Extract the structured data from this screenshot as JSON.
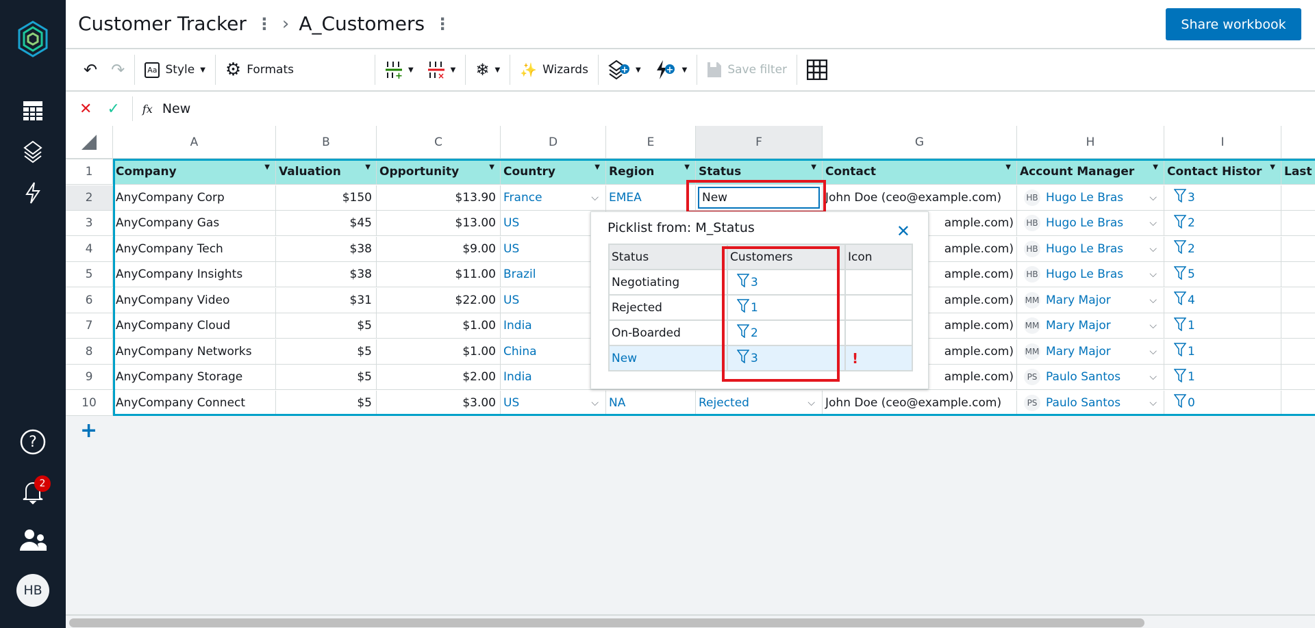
{
  "app": {
    "notifications": 2,
    "user_initials": "HB"
  },
  "header": {
    "workbook": "Customer Tracker",
    "sheet": "A_Customers",
    "share_label": "Share workbook"
  },
  "toolbar": {
    "style": "Style",
    "formats": "Formats",
    "wizards": "Wizards",
    "save_filter": "Save filter"
  },
  "formula": {
    "fx": "fx",
    "value": "New"
  },
  "columns": [
    "A",
    "B",
    "C",
    "D",
    "E",
    "F",
    "G",
    "H",
    "I"
  ],
  "headers": [
    "Company",
    "Valuation",
    "Opportunity",
    "Country",
    "Region",
    "Status",
    "Contact",
    "Account Manager",
    "Contact Histor",
    "Last C"
  ],
  "rows": [
    {
      "n": "2",
      "company": "AnyCompany Corp",
      "valuation": "$150",
      "opportunity": "$13.90",
      "country": "France",
      "region": "EMEA",
      "status": "New",
      "contact": "John Doe (ceo@example.com)",
      "mgr_initials": "HB",
      "manager": "Hugo Le Bras",
      "history": "3"
    },
    {
      "n": "3",
      "company": "AnyCompany Gas",
      "valuation": "$45",
      "opportunity": "$13.00",
      "country": "US",
      "contact": "ample.com)",
      "mgr_initials": "HB",
      "manager": "Hugo Le Bras",
      "history": "2"
    },
    {
      "n": "4",
      "company": "AnyCompany Tech",
      "valuation": "$38",
      "opportunity": "$9.00",
      "country": "US",
      "contact": "ample.com)",
      "mgr_initials": "HB",
      "manager": "Hugo Le Bras",
      "history": "2"
    },
    {
      "n": "5",
      "company": "AnyCompany Insights",
      "valuation": "$38",
      "opportunity": "$11.00",
      "country": "Brazil",
      "contact": "ample.com)",
      "mgr_initials": "HB",
      "manager": "Hugo Le Bras",
      "history": "5"
    },
    {
      "n": "6",
      "company": "AnyCompany Video",
      "valuation": "$31",
      "opportunity": "$22.00",
      "country": "US",
      "contact": "ample.com)",
      "mgr_initials": "MM",
      "manager": "Mary Major",
      "history": "4"
    },
    {
      "n": "7",
      "company": "AnyCompany Cloud",
      "valuation": "$5",
      "opportunity": "$1.00",
      "country": "India",
      "contact": "ample.com)",
      "mgr_initials": "MM",
      "manager": "Mary Major",
      "history": "1"
    },
    {
      "n": "8",
      "company": "AnyCompany Networks",
      "valuation": "$5",
      "opportunity": "$1.00",
      "country": "China",
      "contact": "ample.com)",
      "mgr_initials": "MM",
      "manager": "Mary Major",
      "history": "1"
    },
    {
      "n": "9",
      "company": "AnyCompany Storage",
      "valuation": "$5",
      "opportunity": "$2.00",
      "country": "India",
      "contact": "ample.com)",
      "mgr_initials": "PS",
      "manager": "Paulo Santos",
      "history": "1"
    },
    {
      "n": "10",
      "company": "AnyCompany Connect",
      "valuation": "$5",
      "opportunity": "$3.00",
      "country": "US",
      "region": "NA",
      "status": "Rejected",
      "contact": "John Doe (ceo@example.com)",
      "mgr_initials": "PS",
      "manager": "Paulo Santos",
      "history": "0"
    }
  ],
  "picklist": {
    "title": "Picklist from: M_Status",
    "headers": [
      "Status",
      "Customers",
      "Icon"
    ],
    "items": [
      {
        "status": "Negotiating",
        "customers": "3"
      },
      {
        "status": "Rejected",
        "customers": "1"
      },
      {
        "status": "On-Boarded",
        "customers": "2"
      },
      {
        "status": "New",
        "customers": "3",
        "icon": "exclamation-icon",
        "selected": true
      }
    ]
  },
  "colors": {
    "accent": "#0073bb",
    "header_fill": "#9de8e3",
    "table_border": "#00a1c9",
    "highlight": "#e3161e",
    "sidebar": "#131e2c"
  }
}
